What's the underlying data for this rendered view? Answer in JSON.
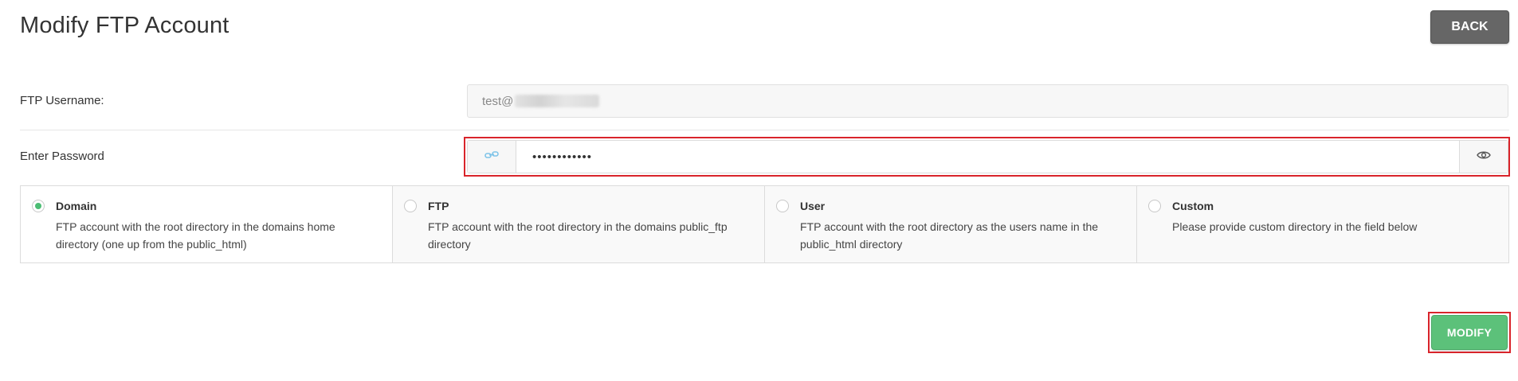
{
  "header": {
    "title": "Modify FTP Account",
    "back_label": "BACK"
  },
  "form": {
    "username_label": "FTP Username:",
    "username_value": "test@",
    "password_label": "Enter Password",
    "password_value": "••••••••••••",
    "generate_icon": "link-generate-icon",
    "show_icon": "eye-icon"
  },
  "directory_options": [
    {
      "title": "Domain",
      "description": "FTP account with the root directory in the domains home directory (one up from the public_html)",
      "checked": true
    },
    {
      "title": "FTP",
      "description": "FTP account with the root directory in the domains public_ftp directory",
      "checked": false
    },
    {
      "title": "User",
      "description": "FTP account with the root directory as the users name in the public_html directory",
      "checked": false
    },
    {
      "title": "Custom",
      "description": "Please provide custom directory in the field below",
      "checked": false
    }
  ],
  "actions": {
    "modify_label": "MODIFY"
  },
  "colors": {
    "highlight": "#d9242b",
    "primary_green": "#5cc17a",
    "back_gray": "#666666",
    "radio_checked": "#4cbd74"
  }
}
